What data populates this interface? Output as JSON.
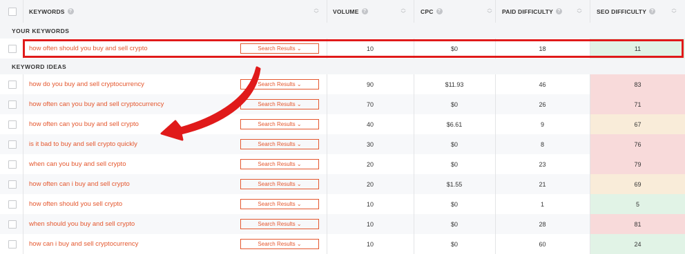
{
  "header": {
    "keywords": "KEYWORDS",
    "volume": "VOLUME",
    "cpc": "CPC",
    "paid_difficulty": "PAID DIFFICULTY",
    "seo_difficulty": "SEO DIFFICULTY",
    "help_glyph": "?"
  },
  "sections": {
    "your_keywords": "YOUR KEYWORDS",
    "keyword_ideas": "KEYWORD IDEAS"
  },
  "search_results_label": "Search Results ⌄",
  "colors": {
    "accent": "#e4572e",
    "highlight_box": "#e01a1a",
    "seo_green": "#e1f3e6",
    "seo_red": "#f8dada",
    "seo_yellow": "#f9ecd9"
  },
  "your_keywords": [
    {
      "keyword": "how often should you buy and sell crypto",
      "volume": "10",
      "cpc": "$0",
      "paid": "18",
      "seo": "11",
      "seo_level": "green"
    }
  ],
  "keyword_ideas": [
    {
      "keyword": "how do you buy and sell cryptocurrency",
      "volume": "90",
      "cpc": "$11.93",
      "paid": "46",
      "seo": "83",
      "seo_level": "red"
    },
    {
      "keyword": "how often can you buy and sell cryptocurrency",
      "volume": "70",
      "cpc": "$0",
      "paid": "26",
      "seo": "71",
      "seo_level": "red"
    },
    {
      "keyword": "how often can you buy and sell crypto",
      "volume": "40",
      "cpc": "$6.61",
      "paid": "9",
      "seo": "67",
      "seo_level": "yellow"
    },
    {
      "keyword": "is it bad to buy and sell crypto quickly",
      "volume": "30",
      "cpc": "$0",
      "paid": "8",
      "seo": "76",
      "seo_level": "red"
    },
    {
      "keyword": "when can you buy and sell crypto",
      "volume": "20",
      "cpc": "$0",
      "paid": "23",
      "seo": "79",
      "seo_level": "red"
    },
    {
      "keyword": "how often can i buy and sell crypto",
      "volume": "20",
      "cpc": "$1.55",
      "paid": "21",
      "seo": "69",
      "seo_level": "yellow"
    },
    {
      "keyword": "how often should you sell crypto",
      "volume": "10",
      "cpc": "$0",
      "paid": "1",
      "seo": "5",
      "seo_level": "green"
    },
    {
      "keyword": "when should you buy and sell crypto",
      "volume": "10",
      "cpc": "$0",
      "paid": "28",
      "seo": "81",
      "seo_level": "red"
    },
    {
      "keyword": "how can i buy and sell cryptocurrency",
      "volume": "10",
      "cpc": "$0",
      "paid": "60",
      "seo": "24",
      "seo_level": "green"
    }
  ]
}
